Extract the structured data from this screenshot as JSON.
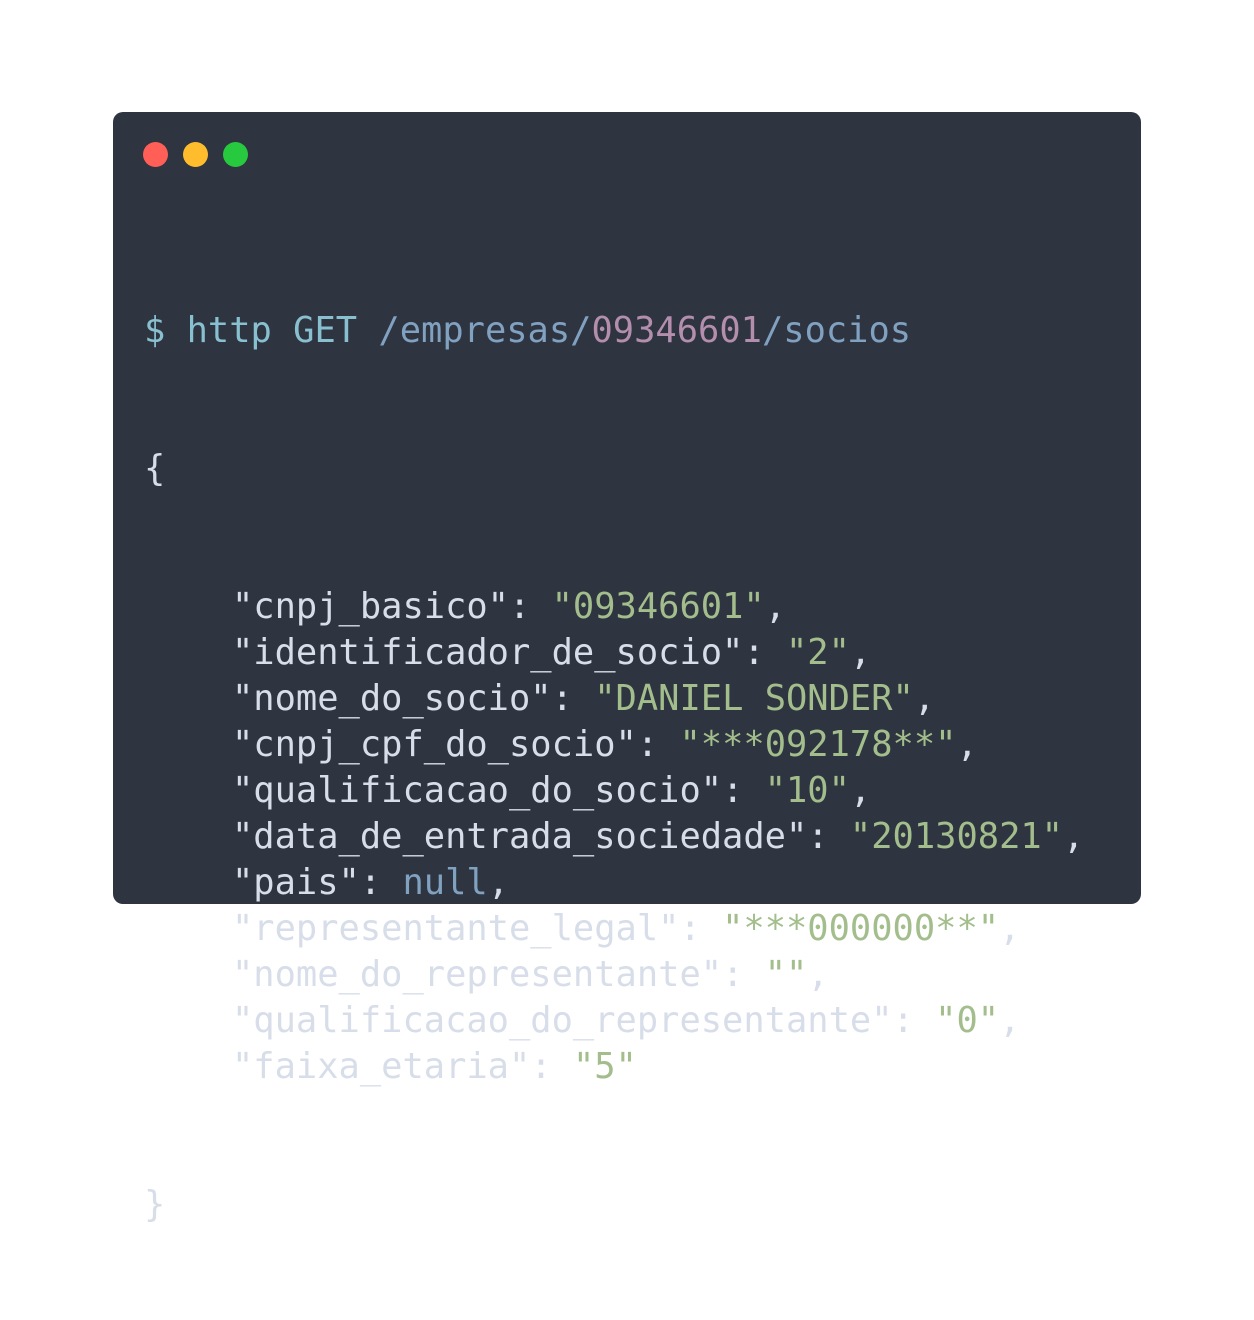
{
  "window": {
    "controls": [
      {
        "name": "close",
        "color": "#ff5f56"
      },
      {
        "name": "minimize",
        "color": "#ffbd2e"
      },
      {
        "name": "maximize",
        "color": "#27c93f"
      }
    ]
  },
  "command": {
    "prompt": "$",
    "tool": "http",
    "method": "GET",
    "path_prefix": "/empresas/",
    "path_id": "09346601",
    "path_suffix": "/socios"
  },
  "response": {
    "open_brace": "{",
    "close_brace": "}",
    "fields": [
      {
        "key": "\"cnpj_basico\"",
        "value": "\"09346601\"",
        "type": "string",
        "comma": ","
      },
      {
        "key": "\"identificador_de_socio\"",
        "value": "\"2\"",
        "type": "string",
        "comma": ","
      },
      {
        "key": "\"nome_do_socio\"",
        "value": "\"DANIEL SONDER\"",
        "type": "string",
        "comma": ","
      },
      {
        "key": "\"cnpj_cpf_do_socio\"",
        "value": "\"***092178**\"",
        "type": "string",
        "comma": ","
      },
      {
        "key": "\"qualificacao_do_socio\"",
        "value": "\"10\"",
        "type": "string",
        "comma": ","
      },
      {
        "key": "\"data_de_entrada_sociedade\"",
        "value": "\"20130821\"",
        "type": "string",
        "comma": ","
      },
      {
        "key": "\"pais\"",
        "value": "null",
        "type": "null",
        "comma": ","
      },
      {
        "key": "\"representante_legal\"",
        "value": "\"***000000**\"",
        "type": "string",
        "comma": ","
      },
      {
        "key": "\"nome_do_representante\"",
        "value": "\"\"",
        "type": "string",
        "comma": ","
      },
      {
        "key": "\"qualificacao_do_representante\"",
        "value": "\"0\"",
        "type": "string",
        "comma": ","
      },
      {
        "key": "\"faixa_etaria\"",
        "value": "\"5\"",
        "type": "string",
        "comma": ""
      }
    ]
  },
  "colors": {
    "background": "#2e3440",
    "text": "#d8dee9",
    "command": "#88c0d0",
    "path": "#81a1c1",
    "number": "#b48ead",
    "string": "#a3be8c",
    "null": "#81a1c1"
  }
}
